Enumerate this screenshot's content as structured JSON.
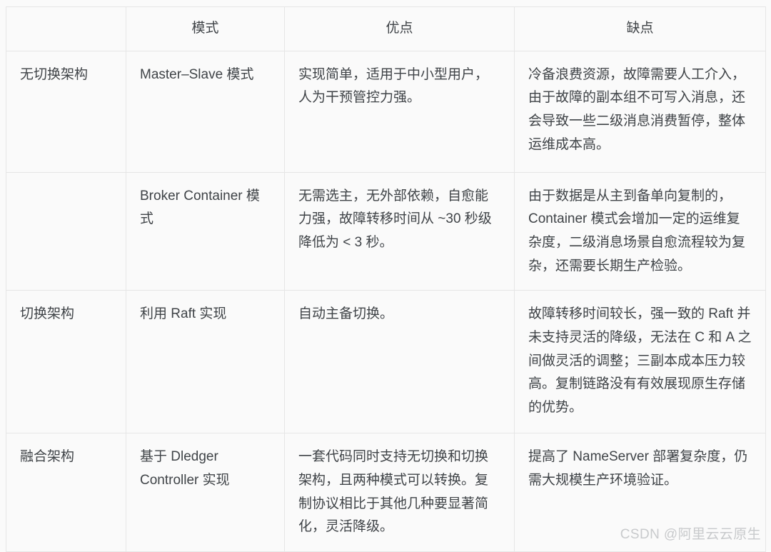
{
  "table": {
    "columns": [
      {
        "key": "category",
        "label": ""
      },
      {
        "key": "mode",
        "label": "模式"
      },
      {
        "key": "pros",
        "label": "优点"
      },
      {
        "key": "cons",
        "label": "缺点"
      }
    ],
    "rows": [
      {
        "category": "无切换架构",
        "mode": "Master–Slave 模式",
        "pros": "实现简单，适用于中小型用户，人为干预管控力强。",
        "cons": "冷备浪费资源，故障需要人工介入，由于故障的副本组不可写入消息，还会导致一些二级消息消费暂停，整体运维成本高。"
      },
      {
        "category": "",
        "mode": "Broker Container 模式",
        "pros": "无需选主，无外部依赖，自愈能力强，故障转移时间从 ~30 秒级降低为 < 3 秒。",
        "cons": "由于数据是从主到备单向复制的，Container 模式会增加一定的运维复杂度，二级消息场景自愈流程较为复杂，还需要长期生产检验。"
      },
      {
        "category": "切换架构",
        "mode": "利用 Raft 实现",
        "pros": "自动主备切换。",
        "cons": "故障转移时间较长，强一致的 Raft 并未支持灵活的降级，无法在 C 和 A 之间做灵活的调整；三副本成本压力较高。复制链路没有有效展现原生存储的优势。"
      },
      {
        "category": "融合架构",
        "mode": "基于 Dledger Controller 实现",
        "pros": "一套代码同时支持无切换和切换架构，且两种模式可以转换。复制协议相比于其他几种要显著简化，灵活降级。",
        "cons": "提高了 NameServer 部署复杂度，仍需大规模生产环境验证。"
      }
    ]
  },
  "watermark": {
    "text": "CSDN @阿里云云原生"
  },
  "colors": {
    "background": "#fafafa",
    "border": "#e6e6e6",
    "text": "#3f4347",
    "watermark": "#c8cacc"
  }
}
